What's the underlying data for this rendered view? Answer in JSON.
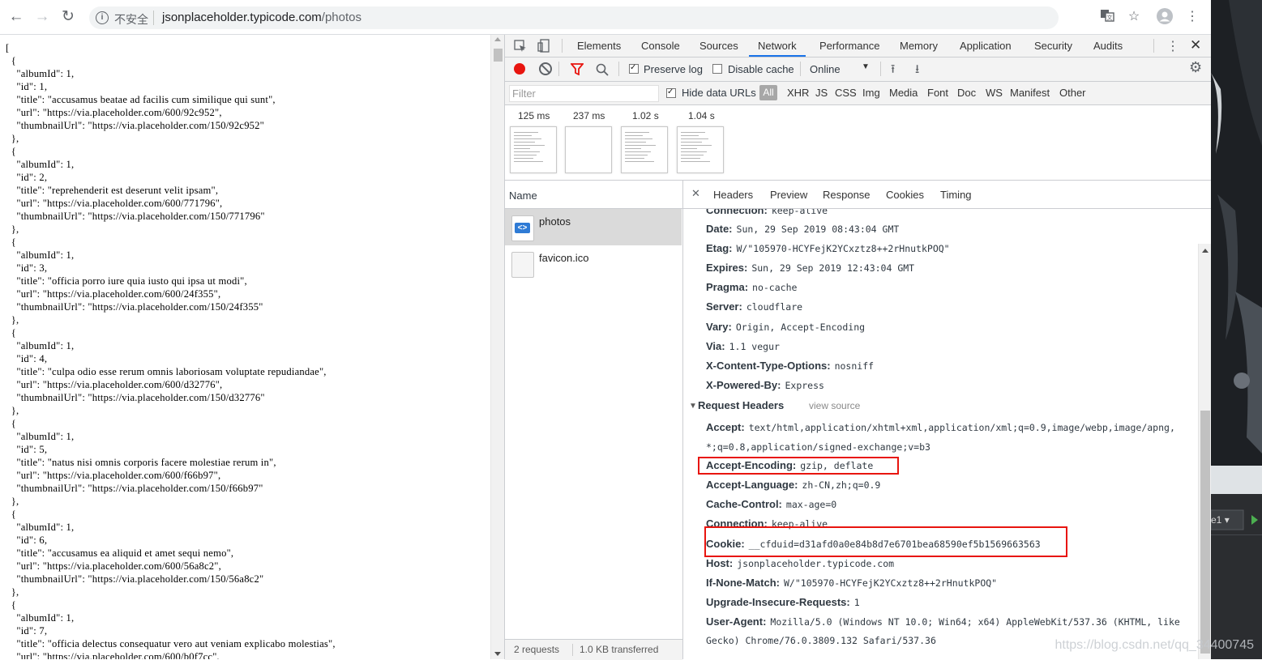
{
  "browser": {
    "security_label": "不安全",
    "url_host": "jsonplaceholder.typicode.com",
    "url_path": "/photos"
  },
  "json_page": {
    "lines": [
      "[",
      "  {",
      "    \"albumId\": 1,",
      "    \"id\": 1,",
      "    \"title\": \"accusamus beatae ad facilis cum similique qui sunt\",",
      "    \"url\": \"https://via.placeholder.com/600/92c952\",",
      "    \"thumbnailUrl\": \"https://via.placeholder.com/150/92c952\"",
      "  },",
      "  {",
      "    \"albumId\": 1,",
      "    \"id\": 2,",
      "    \"title\": \"reprehenderit est deserunt velit ipsam\",",
      "    \"url\": \"https://via.placeholder.com/600/771796\",",
      "    \"thumbnailUrl\": \"https://via.placeholder.com/150/771796\"",
      "  },",
      "  {",
      "    \"albumId\": 1,",
      "    \"id\": 3,",
      "    \"title\": \"officia porro iure quia iusto qui ipsa ut modi\",",
      "    \"url\": \"https://via.placeholder.com/600/24f355\",",
      "    \"thumbnailUrl\": \"https://via.placeholder.com/150/24f355\"",
      "  },",
      "  {",
      "    \"albumId\": 1,",
      "    \"id\": 4,",
      "    \"title\": \"culpa odio esse rerum omnis laboriosam voluptate repudiandae\",",
      "    \"url\": \"https://via.placeholder.com/600/d32776\",",
      "    \"thumbnailUrl\": \"https://via.placeholder.com/150/d32776\"",
      "  },",
      "  {",
      "    \"albumId\": 1,",
      "    \"id\": 5,",
      "    \"title\": \"natus nisi omnis corporis facere molestiae rerum in\",",
      "    \"url\": \"https://via.placeholder.com/600/f66b97\",",
      "    \"thumbnailUrl\": \"https://via.placeholder.com/150/f66b97\"",
      "  },",
      "  {",
      "    \"albumId\": 1,",
      "    \"id\": 6,",
      "    \"title\": \"accusamus ea aliquid et amet sequi nemo\",",
      "    \"url\": \"https://via.placeholder.com/600/56a8c2\",",
      "    \"thumbnailUrl\": \"https://via.placeholder.com/150/56a8c2\"",
      "  },",
      "  {",
      "    \"albumId\": 1,",
      "    \"id\": 7,",
      "    \"title\": \"officia delectus consequatur vero aut veniam explicabo molestias\",",
      "    \"url\": \"https://via.placeholder.com/600/b0f7cc\","
    ]
  },
  "devtools": {
    "tabs": [
      "Elements",
      "Console",
      "Sources",
      "Network",
      "Performance",
      "Memory",
      "Application",
      "Security",
      "Audits"
    ],
    "active_tab": "Network",
    "preserve_log": "Preserve log",
    "disable_cache": "Disable cache",
    "throttle": "Online",
    "filter_placeholder": "Filter",
    "hide_data_urls": "Hide data URLs",
    "types": [
      "All",
      "XHR",
      "JS",
      "CSS",
      "Img",
      "Media",
      "Font",
      "Doc",
      "WS",
      "Manifest",
      "Other"
    ],
    "filmstrip_times": [
      "125 ms",
      "237 ms",
      "1.02 s",
      "1.04 s"
    ],
    "name_header": "Name",
    "requests": [
      "photos",
      "favicon.ico"
    ],
    "footer_requests": "2 requests",
    "footer_transferred": "1.0 KB transferred",
    "detail_tabs": [
      "Headers",
      "Preview",
      "Response",
      "Cookies",
      "Timing"
    ],
    "response_headers": [
      {
        "k": "Connection:",
        "v": "keep-alive"
      },
      {
        "k": "Date:",
        "v": "Sun, 29 Sep 2019 08:43:04 GMT"
      },
      {
        "k": "Etag:",
        "v": "W/\"105970-HCYFejK2YCxztz8++2rHnutkPOQ\""
      },
      {
        "k": "Expires:",
        "v": "Sun, 29 Sep 2019 12:43:04 GMT"
      },
      {
        "k": "Pragma:",
        "v": "no-cache"
      },
      {
        "k": "Server:",
        "v": "cloudflare"
      },
      {
        "k": "Vary:",
        "v": "Origin, Accept-Encoding"
      },
      {
        "k": "Via:",
        "v": "1.1 vegur"
      },
      {
        "k": "X-Content-Type-Options:",
        "v": "nosniff"
      },
      {
        "k": "X-Powered-By:",
        "v": "Express"
      }
    ],
    "request_headers_title": "Request Headers",
    "view_source": "view source",
    "request_headers": [
      {
        "k": "Accept:",
        "v": "text/html,application/xhtml+xml,application/xml;q=0.9,image/webp,image/apng,"
      },
      {
        "k": "",
        "v": "*;q=0.8,application/signed-exchange;v=b3"
      },
      {
        "k": "Accept-Encoding:",
        "v": "gzip, deflate"
      },
      {
        "k": "Accept-Language:",
        "v": "zh-CN,zh;q=0.9"
      },
      {
        "k": "Cache-Control:",
        "v": "max-age=0"
      },
      {
        "k": "Connection:",
        "v": "keep-alive"
      },
      {
        "k": "Cookie:",
        "v": "__cfduid=d31afd0a0e84b8d7e6701bea68590ef5b1569663563"
      },
      {
        "k": "Host:",
        "v": "jsonplaceholder.typicode.com"
      },
      {
        "k": "If-None-Match:",
        "v": "W/\"105970-HCYFejK2YCxztz8++2rHnutkPOQ\""
      },
      {
        "k": "Upgrade-Insecure-Requests:",
        "v": "1"
      },
      {
        "k": "User-Agent:",
        "v": "Mozilla/5.0 (Windows NT 10.0; Win64; x64) AppleWebKit/537.36 (KHTML, like"
      },
      {
        "k": "",
        "v": "Gecko) Chrome/76.0.3809.132 Safari/537.36"
      }
    ]
  },
  "desktop": {
    "dropdown_text": "e1",
    "watermark": "https://blog.csdn.net/qq_34400745"
  },
  "colors": {
    "accent": "#1a73e8",
    "record": "#e8150f",
    "highlight_box": "#e8150f"
  }
}
